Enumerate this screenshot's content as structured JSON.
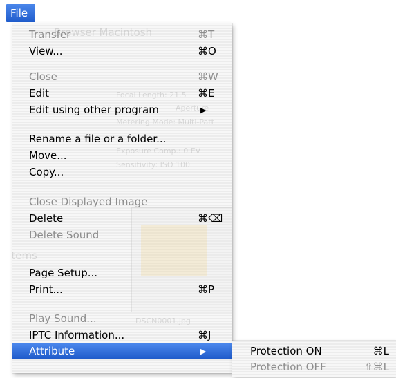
{
  "menubar": {
    "title": "File"
  },
  "menu": {
    "items": [
      {
        "label": "Transfer",
        "shortcut": "⌘T",
        "disabled": true
      },
      {
        "label": "View...",
        "shortcut": "⌘O",
        "disabled": false
      },
      {
        "label": "Close",
        "shortcut": "⌘W",
        "disabled": true
      },
      {
        "label": "Edit",
        "shortcut": "⌘E",
        "disabled": false
      },
      {
        "label": "Edit using other program",
        "submenu_arrow": "▶",
        "disabled": false
      },
      {
        "label": "Rename a file or a folder...",
        "disabled": false
      },
      {
        "label": "Move...",
        "disabled": false
      },
      {
        "label": "Copy...",
        "disabled": false
      },
      {
        "label": "Close Displayed Image",
        "disabled": true
      },
      {
        "label": "Delete",
        "shortcut": "⌘⌫",
        "disabled": false
      },
      {
        "label": "Delete Sound",
        "disabled": true
      },
      {
        "label": "Page Setup...",
        "disabled": false
      },
      {
        "label": "Print...",
        "shortcut": "⌘P",
        "disabled": false
      },
      {
        "label": "Play Sound...",
        "disabled": true
      },
      {
        "label": "IPTC Information...",
        "shortcut": "⌘J",
        "disabled": false
      },
      {
        "label": "Attribute",
        "submenu_arrow": "▶",
        "selected": true
      }
    ]
  },
  "submenu": {
    "items": [
      {
        "label": "Protection ON",
        "shortcut": "⌘L",
        "disabled": false
      },
      {
        "label": "Protection OFF",
        "shortcut": "⇧⌘L",
        "disabled": true
      }
    ]
  },
  "background_ghost": {
    "title": "Browser Macintosh",
    "lines": [
      "Focal Length: 21.5",
      "Aperture",
      "Metering Mode: Multi-Patt",
      "Exposure Comp.: 0 EV",
      "Sensitivity: ISO 100",
      "Items",
      "DSCN0001.jpg"
    ]
  },
  "colors": {
    "highlight": "#2f6fd8",
    "menu_background": "#f4f4f4",
    "disabled_text": "#8d8d8d"
  }
}
